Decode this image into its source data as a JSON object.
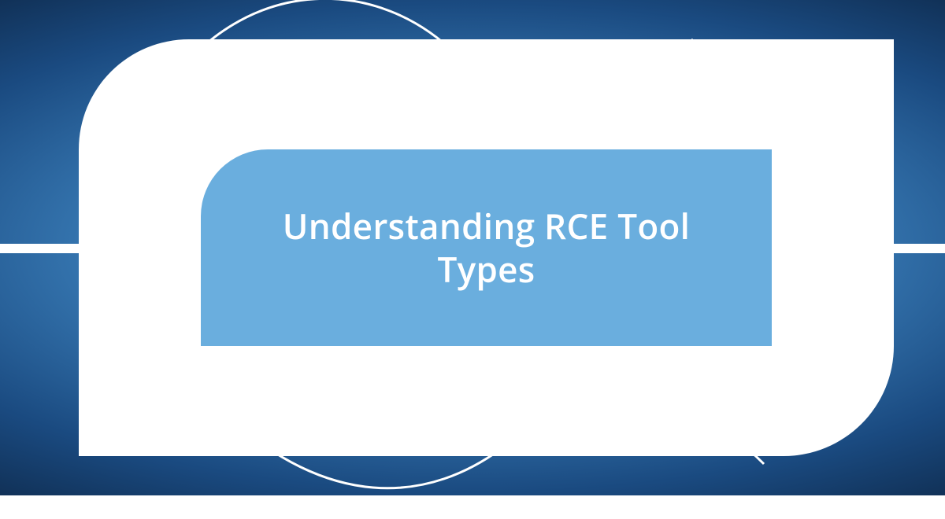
{
  "banner": {
    "title": "Understanding RCE Tool Types"
  },
  "colors": {
    "accent": "#6aaede",
    "shape": "#ffffff",
    "text": "#ffffff"
  }
}
